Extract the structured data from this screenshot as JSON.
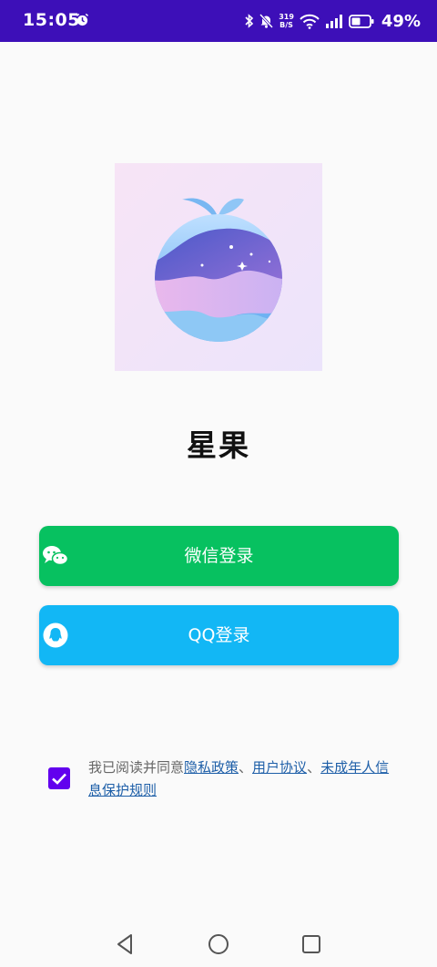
{
  "status_bar": {
    "time": "15:05",
    "net_speed_value": "319",
    "net_speed_unit": "B/S",
    "battery_percent": "49%",
    "background_color": "#3d0fb8"
  },
  "app": {
    "name": "星果",
    "logo_icon": "planet-fruit-logo"
  },
  "login": {
    "wechat_label": "微信登录",
    "wechat_color": "#07c160",
    "qq_label": "QQ登录",
    "qq_color": "#12b7f5"
  },
  "agreement": {
    "checked": true,
    "prefix": "我已阅读并同意",
    "privacy_policy": "隐私政策",
    "sep1": "、",
    "user_agreement": "用户协议",
    "sep2": "、",
    "minor_protection": "未成年人信息保护规则"
  },
  "nav": {
    "back_icon": "back-triangle-icon",
    "home_icon": "home-circle-icon",
    "recents_icon": "recents-square-icon"
  }
}
